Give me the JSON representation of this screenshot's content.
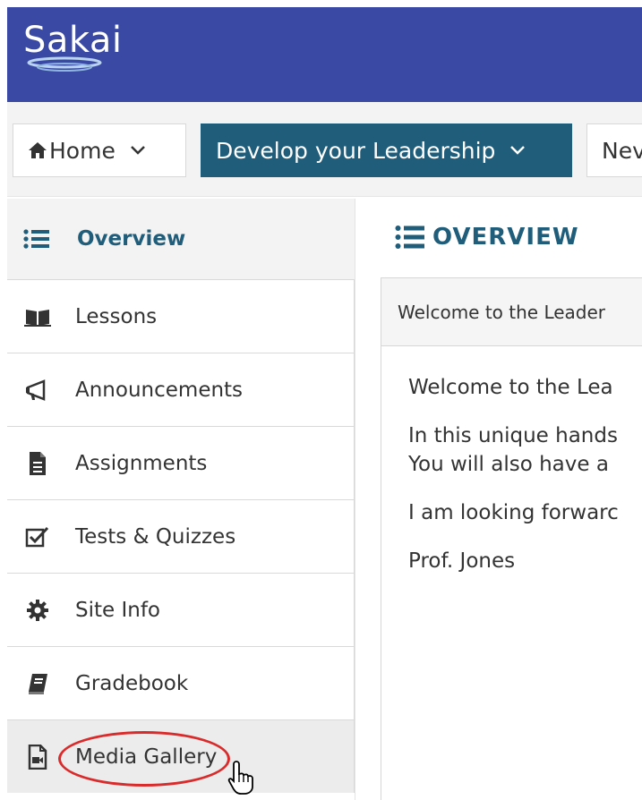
{
  "header": {
    "logo_text": "Sakai",
    "bg_color": "#3a4aa4"
  },
  "site_nav": {
    "home_tab": {
      "label": "Home",
      "icon": "home-icon"
    },
    "leadership_tab": {
      "label": "Develop your Leadership",
      "color": "#1f5d7a"
    },
    "next_tab": {
      "label": "Nev"
    }
  },
  "sidebar": {
    "overview_label": "Overview",
    "items": [
      {
        "label": "Lessons",
        "icon": "book-open-icon"
      },
      {
        "label": "Announcements",
        "icon": "megaphone-icon"
      },
      {
        "label": "Assignments",
        "icon": "file-icon"
      },
      {
        "label": "Tests & Quizzes",
        "icon": "checkbox-icon"
      },
      {
        "label": "Site Info",
        "icon": "gear-icon"
      },
      {
        "label": "Gradebook",
        "icon": "book-icon"
      },
      {
        "label": "Media Gallery",
        "icon": "media-file-icon"
      }
    ]
  },
  "main": {
    "title": "OVERVIEW",
    "panel_title": "Welcome to the Leader",
    "lines": [
      "Welcome to the Lea",
      "In this unique hands",
      "You will also have a",
      "I am looking forwarc",
      "Prof. Jones"
    ]
  }
}
